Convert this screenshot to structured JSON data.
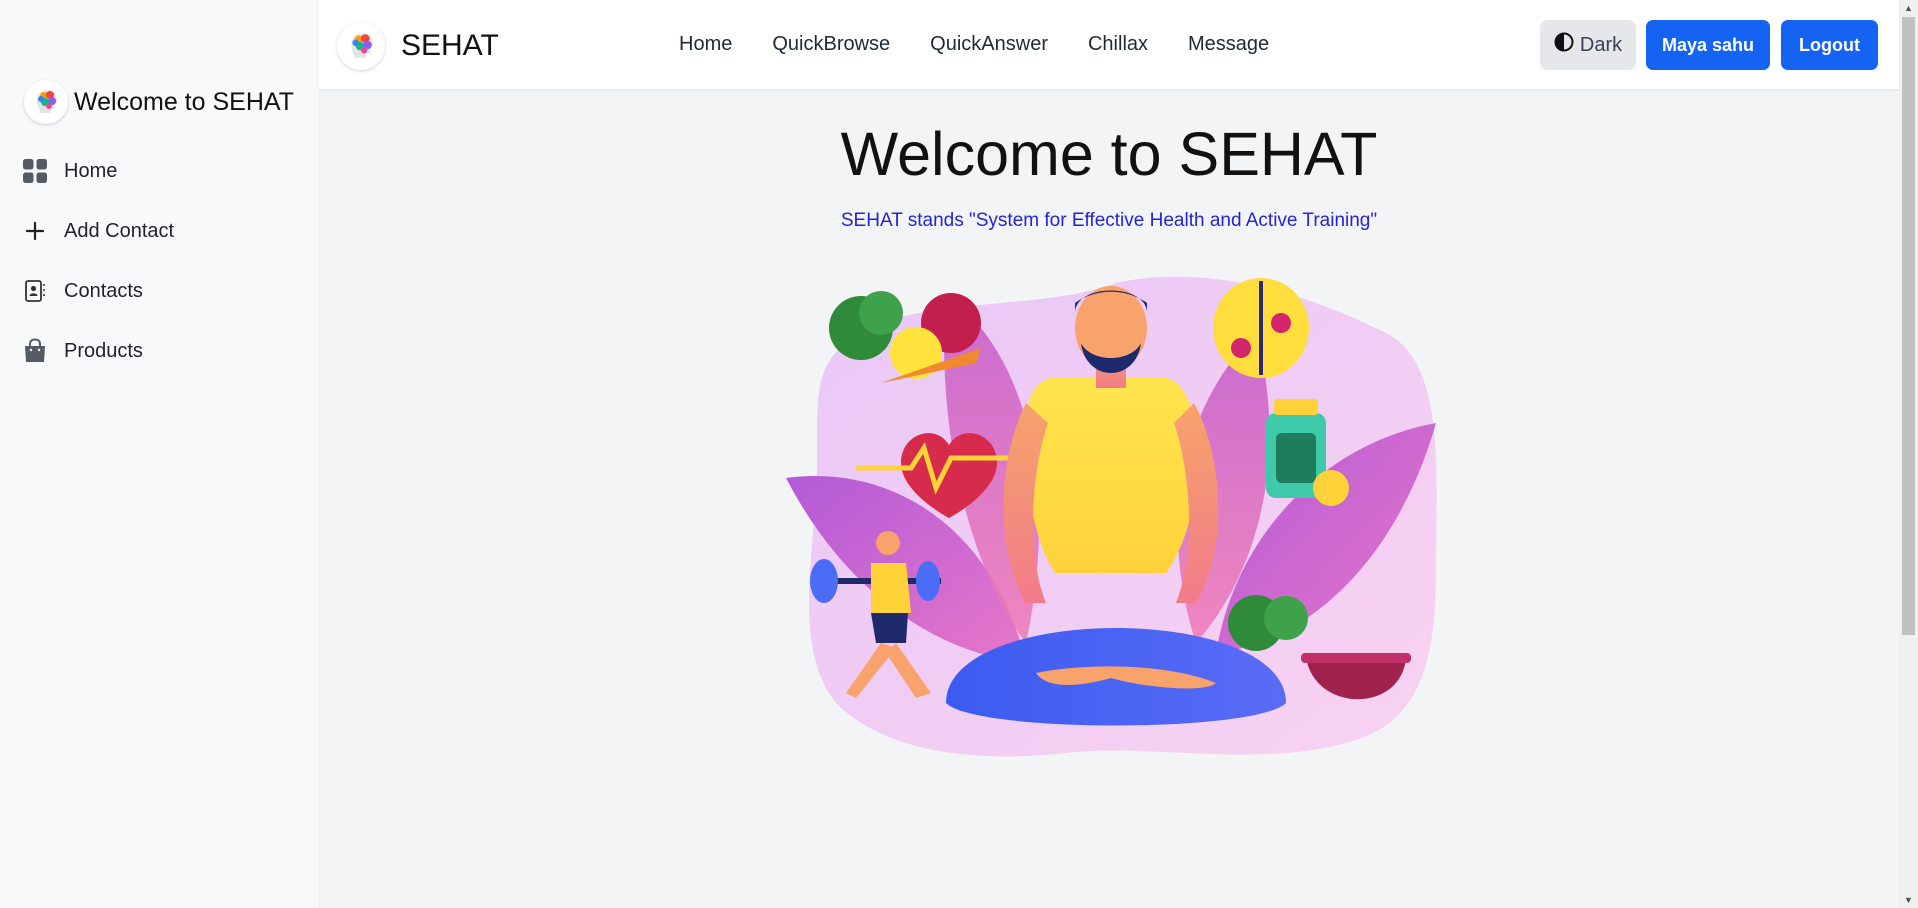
{
  "sidebar": {
    "brand": "Welcome to SEHAT",
    "items": [
      {
        "label": "Home",
        "icon": "grid-icon"
      },
      {
        "label": "Add Contact",
        "icon": "plus-icon"
      },
      {
        "label": "Contacts",
        "icon": "contact-card-icon"
      },
      {
        "label": "Products",
        "icon": "shopping-bag-icon"
      }
    ]
  },
  "header": {
    "brand": "SEHAT",
    "nav": [
      "Home",
      "QuickBrowse",
      "QuickAnswer",
      "Chillax",
      "Message"
    ],
    "dark_label": "Dark",
    "user_label": "Maya sahu",
    "logout_label": "Logout"
  },
  "main": {
    "title": "Welcome to SEHAT",
    "subtitle": "SEHAT stands \"System for Effective Health and Active Training\""
  },
  "colors": {
    "accent": "#1463f3",
    "subtitle": "#2424d6",
    "sidebar_bg": "#f8f9fb",
    "page_bg": "#f3f4f6"
  }
}
